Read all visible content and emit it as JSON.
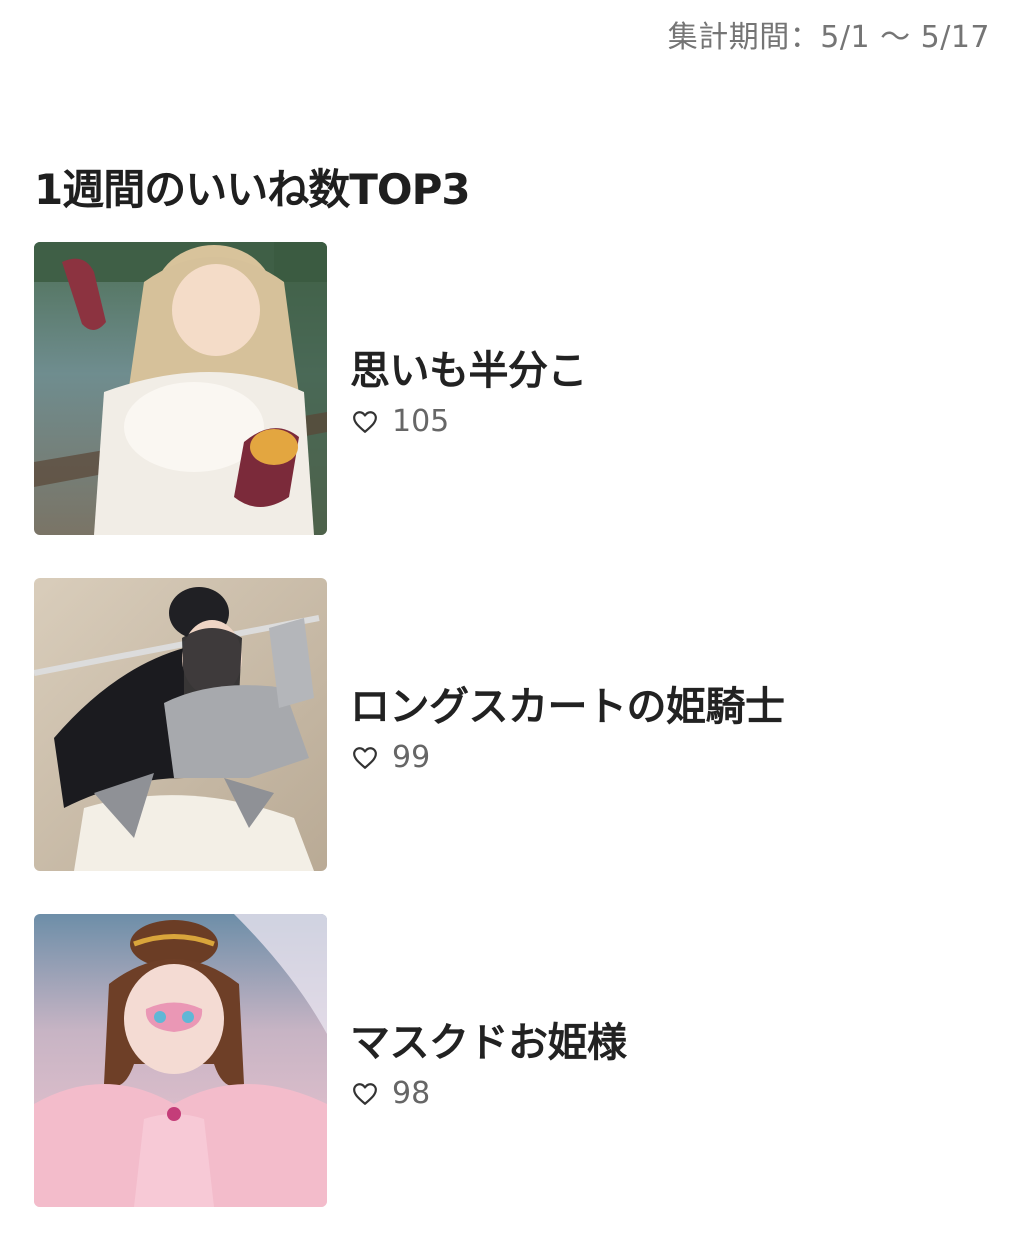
{
  "period": "集計期間：5/1 ～ 5/17",
  "section_title": "1週間のいいね数TOP3",
  "items": [
    {
      "title": "思いも半分こ",
      "likes": "105"
    },
    {
      "title": "ロングスカートの姫騎士",
      "likes": "99"
    },
    {
      "title": "マスクドお姫様",
      "likes": "98"
    }
  ],
  "colors": {
    "text": "#222222",
    "muted": "#757575",
    "background": "#ffffff"
  }
}
